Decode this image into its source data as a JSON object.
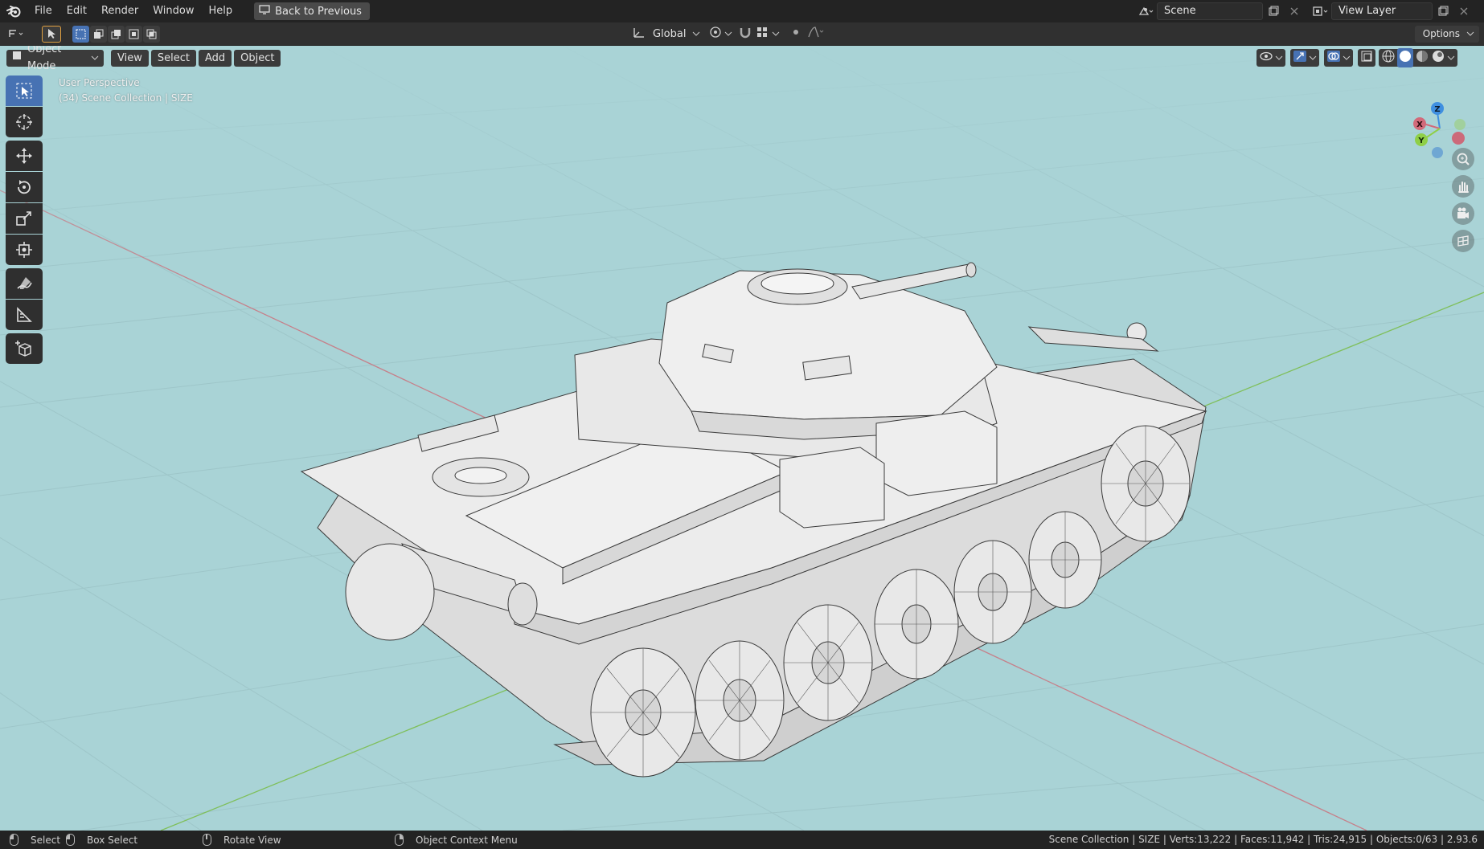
{
  "menubar": {
    "items": [
      "File",
      "Edit",
      "Render",
      "Window",
      "Help"
    ],
    "back_label": "Back to Previous",
    "scene": "Scene",
    "view_layer": "View Layer"
  },
  "toolrow": {
    "orientation": "Global",
    "options": "Options"
  },
  "viewport_header": {
    "mode": "Object Mode",
    "menus": [
      "View",
      "Select",
      "Add",
      "Object"
    ]
  },
  "overlay": {
    "perspective": "User Perspective",
    "collection": "(34) Scene Collection | SIZE"
  },
  "gizmo": {
    "x": "X",
    "y": "Y",
    "z": "Z"
  },
  "tools": [
    "select-box",
    "cursor",
    "move",
    "rotate",
    "scale",
    "transform",
    "annotate",
    "measure",
    "add-cube"
  ],
  "statusbar": {
    "select": "Select",
    "box_select": "Box Select",
    "rotate_view": "Rotate View",
    "context_menu": "Object Context Menu",
    "stats": "Scene Collection | SIZE | Verts:13,222 | Faces:11,942 | Tris:24,915 | Objects:0/63 | 2.93.6"
  },
  "colors": {
    "viewport_bg": "#a9d3d6",
    "accent": "#4772b3",
    "x_axis": "#d26a7a",
    "y_axis": "#8fcf47",
    "z_axis": "#3f8fe0"
  }
}
